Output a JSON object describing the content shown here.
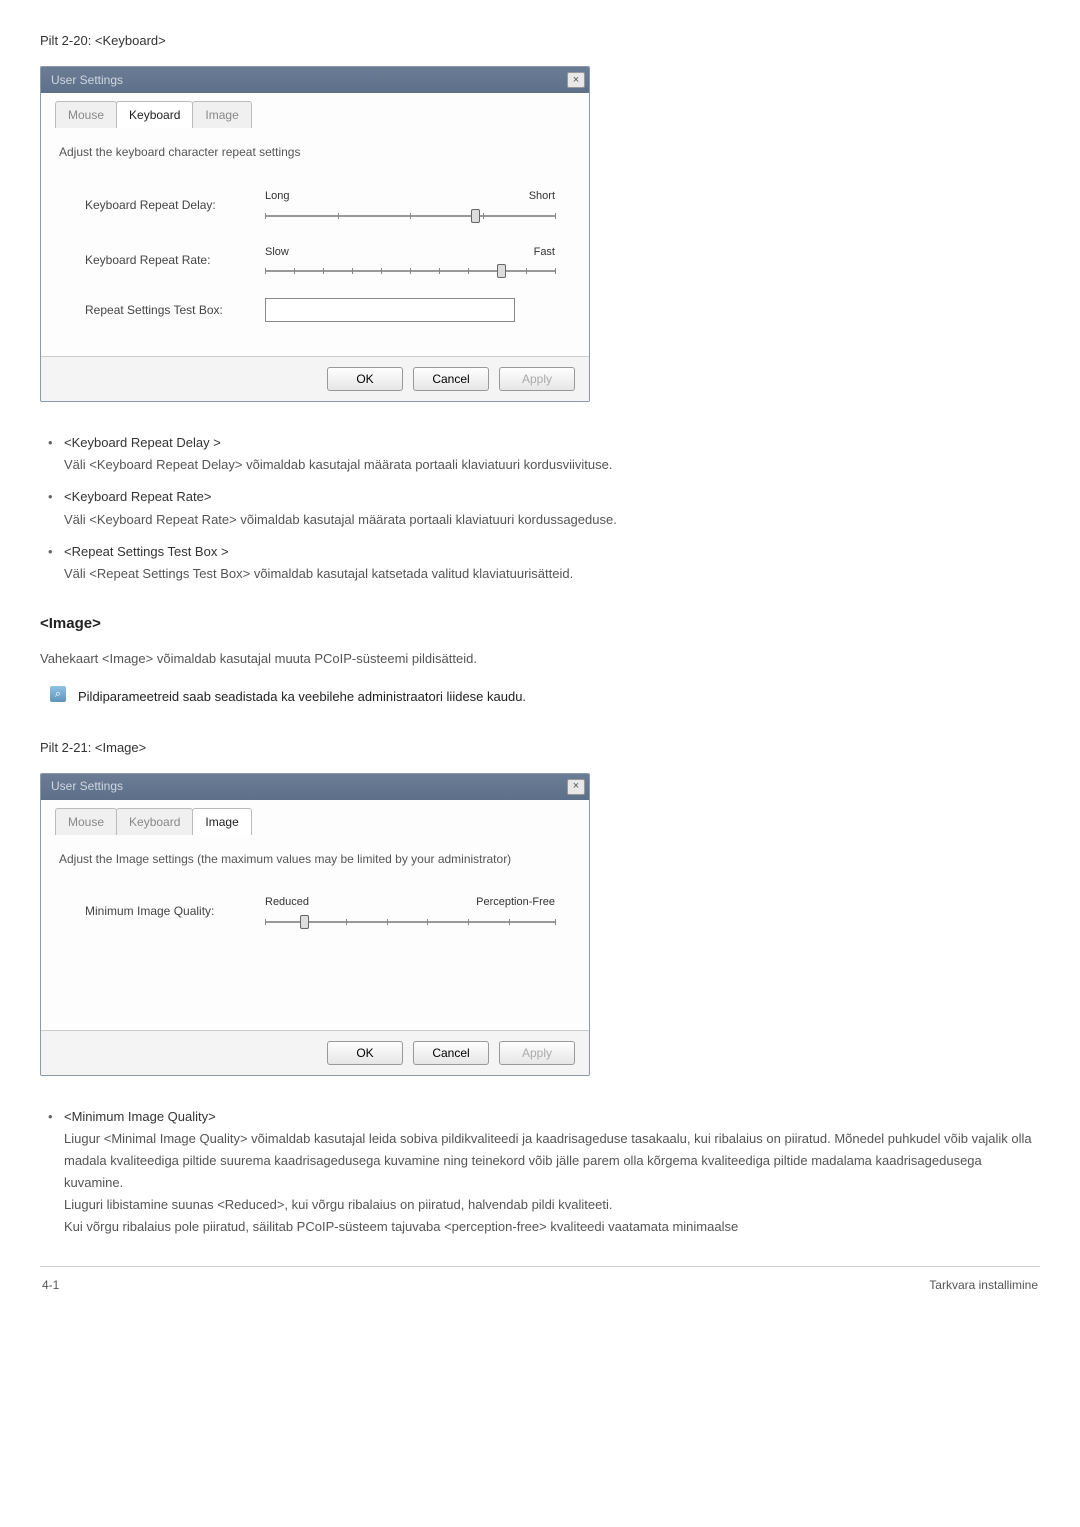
{
  "caption1": "Pilt 2-20: <Keyboard>",
  "dialog1": {
    "title": "User Settings",
    "close": "×",
    "tab_mouse": "Mouse",
    "tab_keyboard": "Keyboard",
    "tab_image": "Image",
    "desc": "Adjust the keyboard character repeat settings",
    "field_delay": "Keyboard Repeat Delay:",
    "delay_left": "Long",
    "delay_right": "Short",
    "field_rate": "Keyboard Repeat Rate:",
    "rate_left": "Slow",
    "rate_right": "Fast",
    "field_test": "Repeat Settings Test Box:",
    "btn_ok": "OK",
    "btn_cancel": "Cancel",
    "btn_apply": "Apply"
  },
  "bullets1": {
    "a_title": "<Keyboard Repeat Delay >",
    "a_desc": "Väli <Keyboard Repeat Delay> võimaldab kasutajal määrata portaali klaviatuuri kordusviivituse.",
    "b_title": "<Keyboard Repeat Rate>",
    "b_desc": "Väli <Keyboard Repeat Rate> võimaldab kasutajal määrata portaali klaviatuuri kordussageduse.",
    "c_title": "<Repeat Settings Test Box >",
    "c_desc": "Väli <Repeat Settings Test Box> võimaldab kasutajal katsetada valitud klaviatuurisätteid."
  },
  "section_title": "<Image>",
  "section_desc": "Vahekaart <Image> võimaldab kasutajal muuta PCoIP-süsteemi pildisätteid.",
  "note_text": "Pildiparameetreid saab seadistada ka veebilehe administraatori liidese kaudu.",
  "caption2": "Pilt 2-21: <Image>",
  "dialog2": {
    "title": "User Settings",
    "close": "×",
    "tab_mouse": "Mouse",
    "tab_keyboard": "Keyboard",
    "tab_image": "Image",
    "desc": "Adjust the Image settings (the maximum values may be limited by your administrator)",
    "field_quality": "Minimum Image Quality:",
    "q_left": "Reduced",
    "q_right": "Perception-Free",
    "btn_ok": "OK",
    "btn_cancel": "Cancel",
    "btn_apply": "Apply"
  },
  "bullets2": {
    "a_title": "<Minimum Image Quality>",
    "a_desc1": "Liugur <Minimal Image Quality> võimaldab kasutajal leida sobiva pildikvaliteedi ja kaadrisageduse tasakaalu, kui ribalaius on piiratud. Mõnedel puhkudel võib vajalik olla madala kvaliteediga piltide suurema kaadrisagedusega kuvamine ning teinekord võib jälle parem olla kõrgema kvaliteediga piltide madalama kaadrisagedusega kuvamine.",
    "a_desc2": "Liuguri libistamine suunas <Reduced>, kui võrgu ribalaius on piiratud, halvendab pildi kvaliteeti.",
    "a_desc3": "Kui võrgu ribalaius pole piiratud, säilitab PCoIP-süsteem tajuvaba <perception-free> kvaliteedi vaatamata minimaalse"
  },
  "footer_left": "4-1",
  "footer_right": "Tarkvara installimine"
}
